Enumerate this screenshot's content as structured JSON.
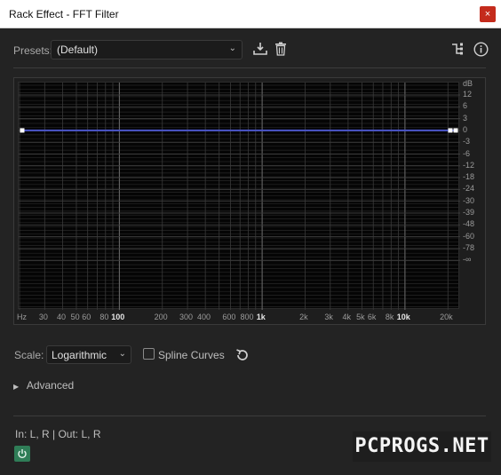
{
  "window": {
    "title": "Rack Effect - FFT Filter",
    "close_glyph": "×"
  },
  "presets": {
    "label": "Presets:",
    "selected": "(Default)",
    "icons": [
      "save-preset-icon",
      "delete-preset-icon",
      "routing-icon",
      "info-icon"
    ]
  },
  "graph": {
    "db_unit": "dB",
    "db_ticks": [
      "12",
      "6",
      "3",
      "0",
      "-3",
      "-6",
      "-12",
      "-18",
      "-24",
      "-30",
      "-39",
      "-48",
      "-60",
      "-78",
      "-∞"
    ],
    "freq_unit": "Hz",
    "freq_ticks": [
      {
        "label": "30",
        "hz": 30,
        "major": false
      },
      {
        "label": "40",
        "hz": 40,
        "major": false
      },
      {
        "label": "50",
        "hz": 50,
        "major": false
      },
      {
        "label": "60",
        "hz": 60,
        "major": false
      },
      {
        "label": "80",
        "hz": 80,
        "major": false
      },
      {
        "label": "100",
        "hz": 100,
        "major": true
      },
      {
        "label": "200",
        "hz": 200,
        "major": false
      },
      {
        "label": "300",
        "hz": 300,
        "major": false
      },
      {
        "label": "400",
        "hz": 400,
        "major": false
      },
      {
        "label": "600",
        "hz": 600,
        "major": false
      },
      {
        "label": "800",
        "hz": 800,
        "major": false
      },
      {
        "label": "1k",
        "hz": 1000,
        "major": true
      },
      {
        "label": "2k",
        "hz": 2000,
        "major": false
      },
      {
        "label": "3k",
        "hz": 3000,
        "major": false
      },
      {
        "label": "4k",
        "hz": 4000,
        "major": false
      },
      {
        "label": "5k",
        "hz": 5000,
        "major": false
      },
      {
        "label": "6k",
        "hz": 6000,
        "major": false
      },
      {
        "label": "8k",
        "hz": 8000,
        "major": false
      },
      {
        "label": "10k",
        "hz": 10000,
        "major": true
      },
      {
        "label": "20k",
        "hz": 20000,
        "major": false
      }
    ],
    "curve_db": 0,
    "curve_color": "#4a55c8"
  },
  "scale": {
    "label": "Scale:",
    "selected": "Logarithmic"
  },
  "spline": {
    "label": "Spline Curves",
    "checked": false
  },
  "advanced": {
    "label": "Advanced",
    "arrow": "▶"
  },
  "io": {
    "label": "In: L, R | Out: L, R"
  },
  "power": {
    "on": true,
    "color": "#2f7d57"
  },
  "watermark": {
    "text": "PCPROGS.NET"
  }
}
